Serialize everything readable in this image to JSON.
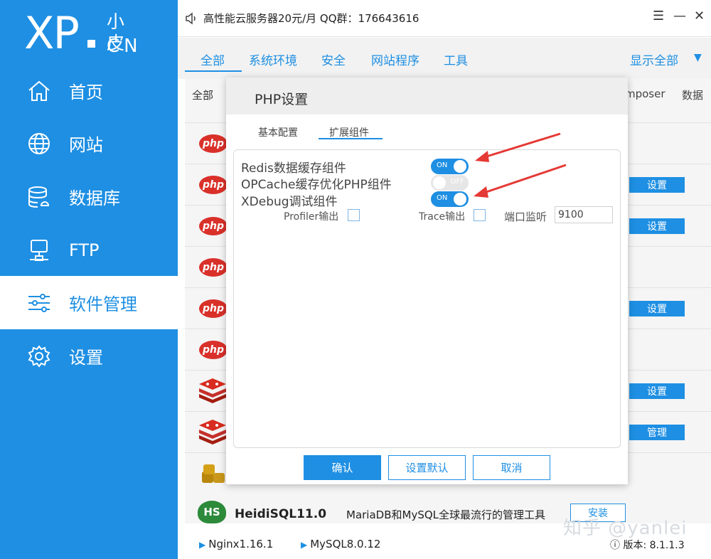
{
  "app": {
    "logo_main": "XP",
    "logo_cn_top": "小皮",
    "logo_cn_bottom": "CN"
  },
  "sidebar": {
    "items": [
      {
        "label": "首页",
        "icon": "home-icon"
      },
      {
        "label": "网站",
        "icon": "globe-icon"
      },
      {
        "label": "数据库",
        "icon": "database-icon"
      },
      {
        "label": "FTP",
        "icon": "server-icon"
      },
      {
        "label": "软件管理",
        "icon": "sliders-icon",
        "active": true
      },
      {
        "label": "设置",
        "icon": "gear-icon"
      }
    ]
  },
  "topbar": {
    "notice": "高性能云服务器20元/月  QQ群：176643616",
    "menu_icon": "☰",
    "minimize_icon": "—",
    "close_icon": "✕"
  },
  "tabs": {
    "items": [
      "全部",
      "系统环境",
      "安全",
      "网站程序",
      "工具"
    ],
    "active": "全部",
    "show_all": "显示全部",
    "show_all_arrow": "▼"
  },
  "table": {
    "header_all": "全部",
    "header_composer": "mposer",
    "header_data": "数据",
    "php_badge": "php",
    "buttons": {
      "row2": "设置",
      "row3": "设置",
      "row5": "设置",
      "row7": "设置",
      "row8": "管理"
    },
    "heidi": {
      "badge": "HS",
      "name": "HeidiSQL11.0",
      "desc": "MariaDB和MySQL全球最流行的管理工具",
      "button": "安装"
    }
  },
  "statusbar": {
    "nginx": "Nginx1.16.1",
    "mysql": "MySQL8.0.12",
    "watermark": "知乎 @yanlei",
    "version": "ⓘ 版本:  8.1.1.3"
  },
  "dialog": {
    "title": "PHP设置",
    "tabs": [
      "基本配置",
      "扩展组件"
    ],
    "active_tab": "扩展组件",
    "options": [
      {
        "label": "Redis数据缓存组件",
        "state": "ON"
      },
      {
        "label": "OPCache缓存优化PHP组件",
        "state": "OFF"
      },
      {
        "label": "XDebug调试组件",
        "state": "ON"
      }
    ],
    "profiler_label": "Profiler输出",
    "trace_label": "Trace输出",
    "port_label": "端口监听",
    "port_value": "9100",
    "buttons": {
      "confirm": "确认",
      "set_default": "设置默认",
      "cancel": "取消"
    }
  },
  "colors": {
    "accent": "#1e8fe3",
    "php_red": "#d9312a",
    "annotation_arrow": "#e53935"
  }
}
